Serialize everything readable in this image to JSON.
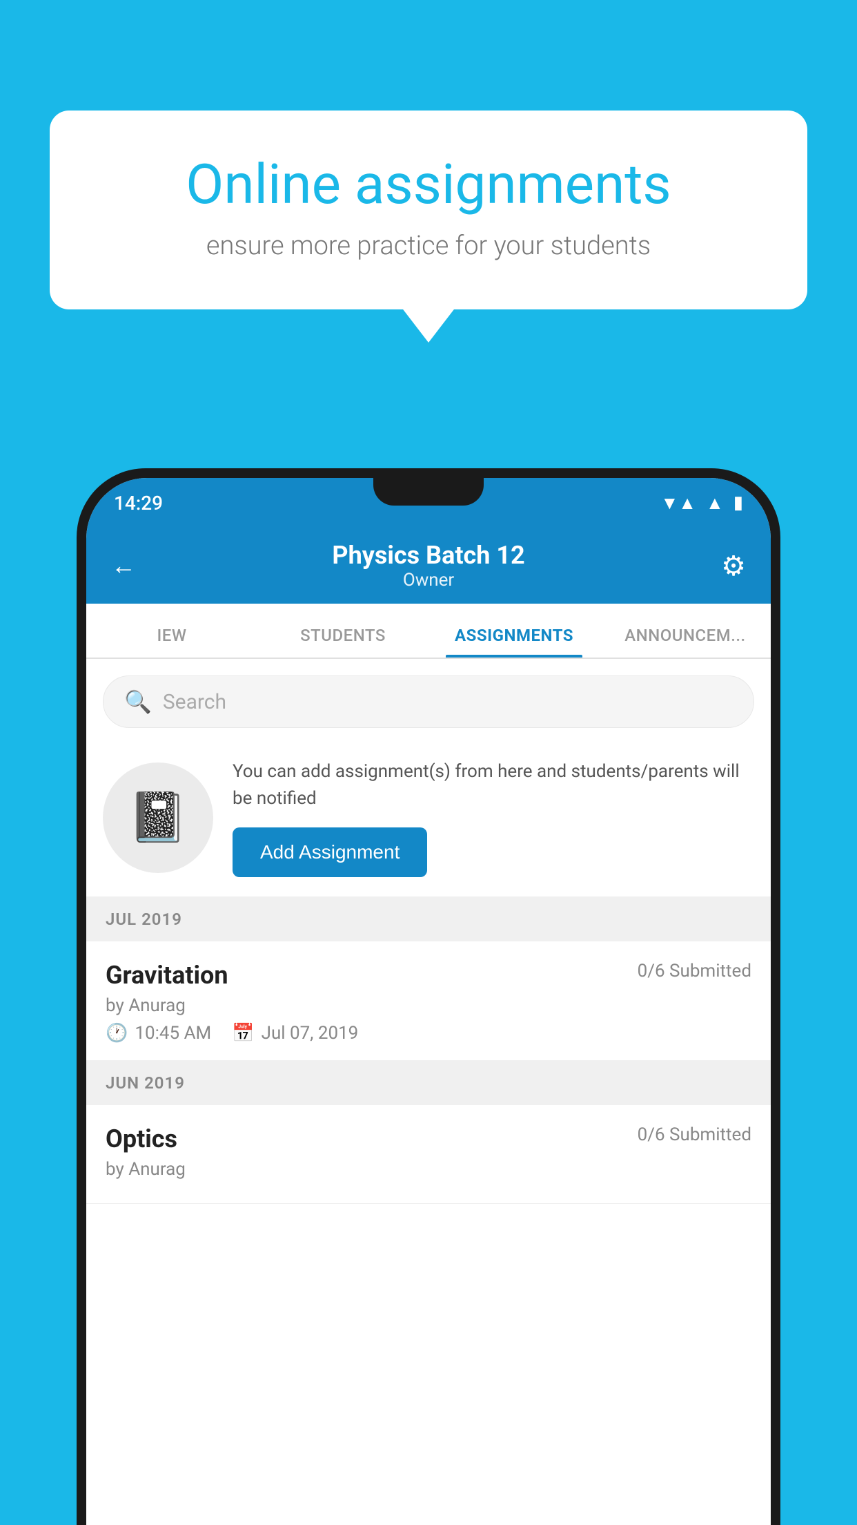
{
  "background_color": "#1ab8e8",
  "speech_bubble": {
    "title": "Online assignments",
    "subtitle": "ensure more practice for your students"
  },
  "status_bar": {
    "time": "14:29",
    "icons": [
      "wifi",
      "signal",
      "battery"
    ]
  },
  "app_header": {
    "title": "Physics Batch 12",
    "subtitle": "Owner",
    "back_label": "←",
    "settings_label": "⚙"
  },
  "tabs": [
    {
      "label": "IEW",
      "active": false
    },
    {
      "label": "STUDENTS",
      "active": false
    },
    {
      "label": "ASSIGNMENTS",
      "active": true
    },
    {
      "label": "ANNOUNCEM...",
      "active": false
    }
  ],
  "search": {
    "placeholder": "Search"
  },
  "promo": {
    "text": "You can add assignment(s) from here and students/parents will be notified",
    "button_label": "Add Assignment"
  },
  "month_groups": [
    {
      "month": "JUL 2019",
      "assignments": [
        {
          "title": "Gravitation",
          "submitted": "0/6 Submitted",
          "author": "by Anurag",
          "time": "10:45 AM",
          "date": "Jul 07, 2019"
        }
      ]
    },
    {
      "month": "JUN 2019",
      "assignments": [
        {
          "title": "Optics",
          "submitted": "0/6 Submitted",
          "author": "by Anurag",
          "time": "",
          "date": ""
        }
      ]
    }
  ]
}
